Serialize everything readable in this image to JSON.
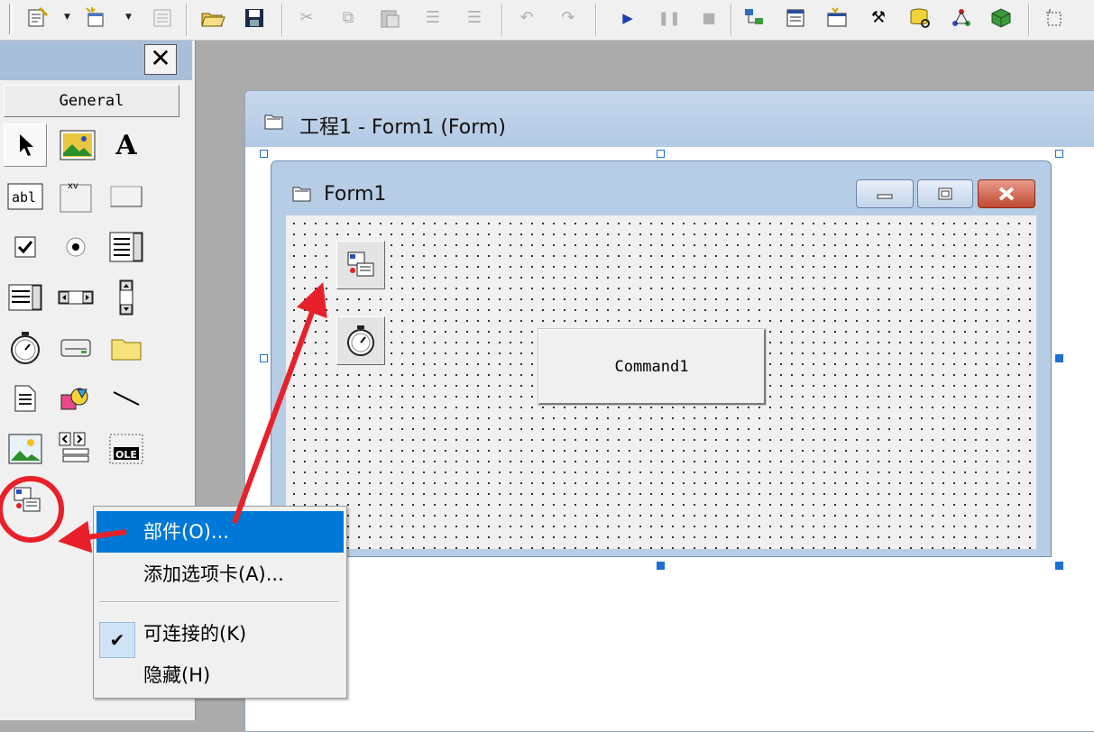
{
  "toolbar": {
    "icons": [
      "vb-project-icon",
      "dropdown-arrow",
      "add-form-icon",
      "dropdown-arrow",
      "menu-editor-icon",
      "open-icon",
      "save-icon",
      "cut-icon",
      "copy-icon",
      "paste-icon",
      "find-icon",
      "indent-icon",
      "outdent-icon",
      "undo-icon",
      "redo-icon",
      "run-icon",
      "pause-icon",
      "stop-icon",
      "project-explorer-icon",
      "properties-window-icon",
      "form-layout-icon",
      "object-browser-icon",
      "toolbox-icon",
      "data-view-icon",
      "component-manager-icon",
      "add-control-icon"
    ]
  },
  "toolbox": {
    "close_glyph": "✕",
    "tab_label": "General",
    "tools": [
      "pointer-tool",
      "picturebox-tool",
      "label-tool",
      "textbox-tool",
      "frame-tool",
      "commandbutton-tool",
      "checkbox-tool",
      "optionbutton-tool",
      "combobox-tool",
      "listbox-tool",
      "hscrollbar-tool",
      "vscrollbar-tool",
      "timer-tool",
      "drivelistbox-tool",
      "dirlistbox-tool",
      "filelistbox-tool",
      "shape-tool",
      "line-tool",
      "image-tool",
      "data-tool",
      "ole-tool",
      "custom-control-tool"
    ]
  },
  "designer": {
    "title": "工程1 - Form1 (Form)"
  },
  "form1": {
    "title": "Form1",
    "command_button": "Command1"
  },
  "context_menu": {
    "items": [
      {
        "label": "部件(O)...",
        "highlighted": true
      },
      {
        "label": "添加选项卡(A)..."
      },
      {
        "label": "可连接的(K)",
        "checked": true
      },
      {
        "label": "隐藏(H)"
      }
    ]
  },
  "colors": {
    "highlight": "#0078d7",
    "annotation_red": "#e8202a",
    "title_bar": "#b7cde6"
  }
}
